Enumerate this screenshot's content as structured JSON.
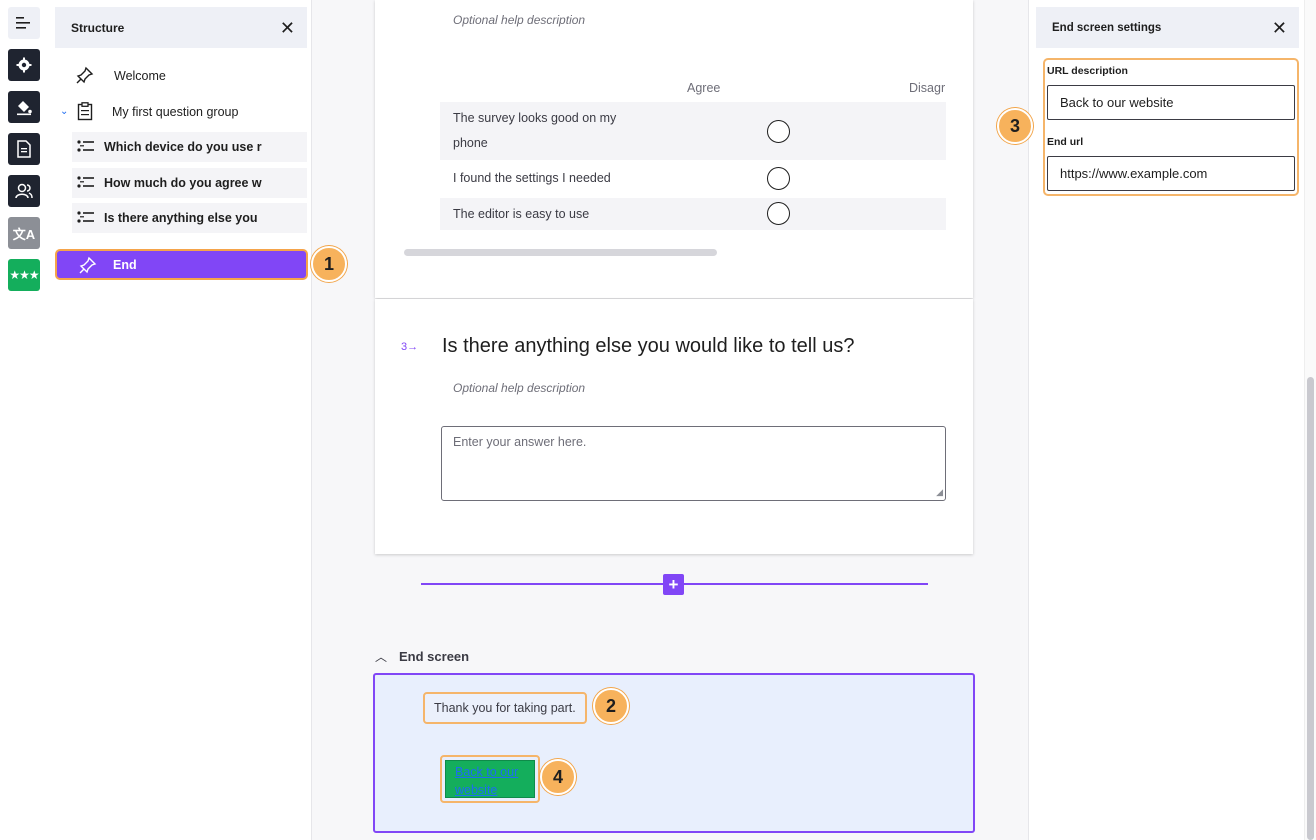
{
  "structure": {
    "title": "Structure",
    "items": [
      {
        "label": "Welcome"
      },
      {
        "label": "My first question group"
      },
      {
        "label": "Which device do you use r"
      },
      {
        "label": "How much do you agree w"
      },
      {
        "label": "Is there anything else you"
      },
      {
        "label": "End"
      }
    ]
  },
  "badges": [
    "1",
    "2",
    "3",
    "4"
  ],
  "matrix_question": {
    "help": "Optional help description",
    "columns": [
      "Agree",
      "Disagr"
    ],
    "rows": [
      {
        "line1": "The survey looks good on my",
        "line2": "phone"
      },
      {
        "line1": "I found the settings I needed"
      },
      {
        "line1": "The editor is easy to use"
      }
    ]
  },
  "text_question": {
    "number": "3→",
    "title": "Is there anything else you would like to tell us?",
    "help": "Optional help description",
    "placeholder": "Enter your answer here."
  },
  "end_screen": {
    "label": "End screen",
    "thank_you": "Thank you for taking part.",
    "button_line1": "Back to our",
    "button_line2": "website"
  },
  "settings": {
    "title": "End screen settings",
    "url_description_label": "URL description",
    "url_description_value": "Back to our website",
    "end_url_label": "End url",
    "end_url_value": "https://www.example.com"
  },
  "colors": {
    "accent": "#8146f6",
    "highlight": "#f5a44a",
    "success": "#14ae5c"
  }
}
